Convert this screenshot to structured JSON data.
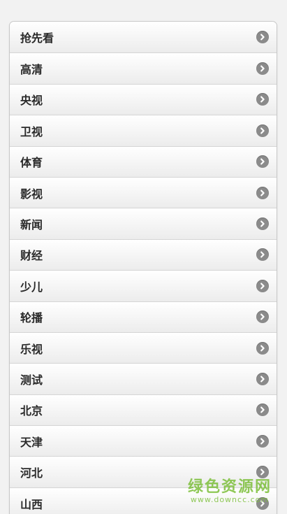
{
  "channels": [
    {
      "label": "抢先看"
    },
    {
      "label": "高清"
    },
    {
      "label": "央视"
    },
    {
      "label": "卫视"
    },
    {
      "label": "体育"
    },
    {
      "label": "影视"
    },
    {
      "label": "新闻"
    },
    {
      "label": "财经"
    },
    {
      "label": "少儿"
    },
    {
      "label": "轮播"
    },
    {
      "label": "乐视"
    },
    {
      "label": "测试"
    },
    {
      "label": "北京"
    },
    {
      "label": "天津"
    },
    {
      "label": "河北"
    },
    {
      "label": "山西"
    }
  ],
  "arrow_icon": "chevron-right-circle-icon",
  "colors": {
    "arrow_bg": "#8b8b8b",
    "label_text": "#2a2a2a",
    "watermark": "#7cbf3a"
  },
  "watermark": {
    "main": "绿色资源网",
    "sub": "www.downcc.com"
  }
}
